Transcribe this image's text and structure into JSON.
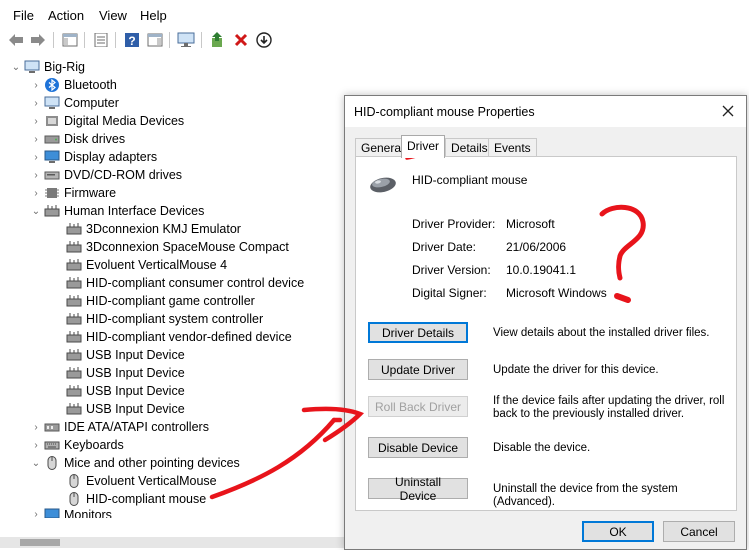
{
  "menu": {
    "file": "File",
    "action": "Action",
    "view": "View",
    "help": "Help"
  },
  "toolbar": {
    "icons": [
      "back-arrow-icon",
      "forward-arrow-icon",
      "show-hide-tree-icon",
      "properties-icon",
      "help-icon",
      "action-pane-icon",
      "scan-hardware-icon",
      "update-driver-icon",
      "uninstall-icon",
      "disable-icon"
    ]
  },
  "tree": {
    "root": "Big-Rig",
    "categories": [
      "Bluetooth",
      "Computer",
      "Digital Media Devices",
      "Disk drives",
      "Display adapters",
      "DVD/CD-ROM drives",
      "Firmware",
      "Human Interface Devices"
    ],
    "hid_children": [
      "3Dconnexion KMJ Emulator",
      "3Dconnexion SpaceMouse Compact",
      "Evoluent VerticalMouse 4",
      "HID-compliant consumer control device",
      "HID-compliant game controller",
      "HID-compliant system controller",
      "HID-compliant vendor-defined device",
      "USB Input Device",
      "USB Input Device",
      "USB Input Device",
      "USB Input Device"
    ],
    "after": [
      "IDE ATA/ATAPI controllers",
      "Keyboards",
      "Mice and other pointing devices"
    ],
    "mice_children": [
      "Evoluent VerticalMouse",
      "HID-compliant mouse"
    ],
    "partial": "Monitors"
  },
  "dialog": {
    "title": "HID-compliant mouse Properties",
    "tabs": [
      "General",
      "Driver",
      "Details",
      "Events"
    ],
    "device_name": "HID-compliant mouse",
    "props": [
      {
        "label": "Driver Provider:",
        "value": "Microsoft"
      },
      {
        "label": "Driver Date:",
        "value": "21/06/2006"
      },
      {
        "label": "Driver Version:",
        "value": "10.0.19041.1"
      },
      {
        "label": "Digital Signer:",
        "value": "Microsoft Windows"
      }
    ],
    "buttons": [
      {
        "label": "Driver Details",
        "desc": "View details about the installed driver files."
      },
      {
        "label": "Update Driver",
        "desc": "Update the driver for this device."
      },
      {
        "label": "Roll Back Driver",
        "desc": "If the device fails after updating the driver, roll back to the previously installed driver."
      },
      {
        "label": "Disable Device",
        "desc": "Disable the device."
      },
      {
        "label": "Uninstall Device",
        "desc": "Uninstall the device from the system (Advanced)."
      }
    ],
    "ok": "OK",
    "cancel": "Cancel"
  },
  "annotation_color": "#e8141b"
}
